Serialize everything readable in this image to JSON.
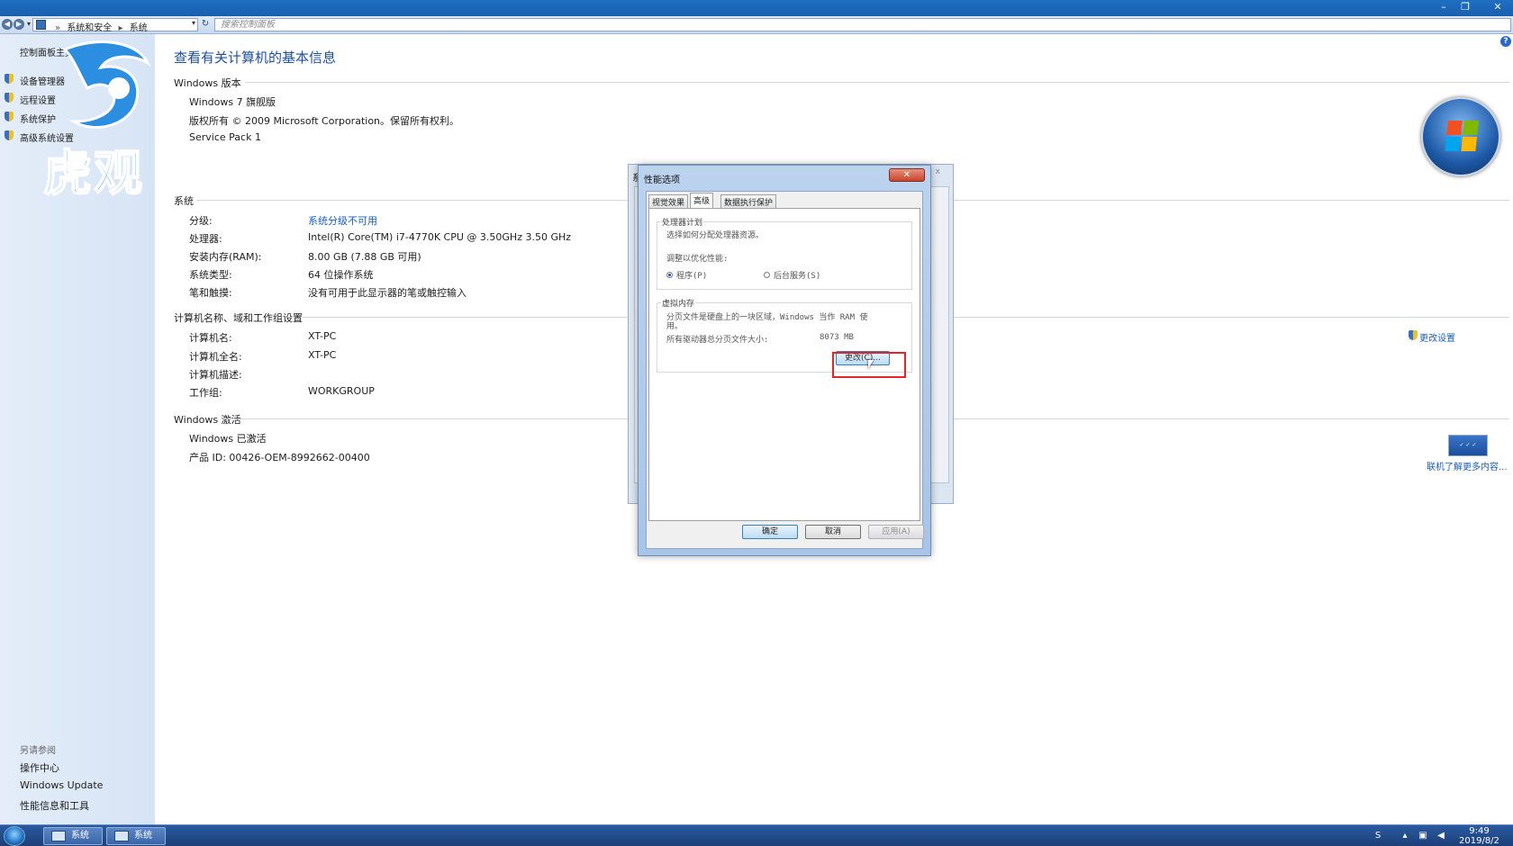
{
  "titlebar": {
    "minimize": "–",
    "maximize": "❐",
    "close": "✕"
  },
  "address": {
    "crumbs": [
      "系统和安全",
      "系统"
    ],
    "search_placeholder": "搜索控制面板"
  },
  "sidebar": {
    "home": "控制面板主页",
    "items": [
      {
        "label": "设备管理器"
      },
      {
        "label": "远程设置"
      },
      {
        "label": "系统保护"
      },
      {
        "label": "高级系统设置"
      }
    ],
    "see_also": "另请参阅",
    "links": [
      "操作中心",
      "Windows Update",
      "性能信息和工具"
    ]
  },
  "watermark": {
    "text": "虎观"
  },
  "main": {
    "title": "查看有关计算机的基本信息",
    "edition": {
      "heading": "Windows 版本",
      "lines": [
        "Windows 7 旗舰版",
        "版权所有 © 2009 Microsoft Corporation。保留所有权利。",
        "Service Pack 1"
      ]
    },
    "system": {
      "heading": "系统",
      "rows": [
        {
          "label": "分级:",
          "value": "系统分级不可用"
        },
        {
          "label": "处理器:",
          "value": "Intel(R) Core(TM) i7-4770K CPU @ 3.50GHz   3.50 GHz"
        },
        {
          "label": "安装内存(RAM):",
          "value": "8.00 GB (7.88 GB 可用)"
        },
        {
          "label": "系统类型:",
          "value": "64 位操作系统"
        },
        {
          "label": "笔和触摸:",
          "value": "没有可用于此显示器的笔或触控输入"
        }
      ]
    },
    "computer": {
      "heading": "计算机名称、域和工作组设置",
      "rows": [
        {
          "label": "计算机名:",
          "value": "XT-PC"
        },
        {
          "label": "计算机全名:",
          "value": "XT-PC"
        },
        {
          "label": "计算机描述:",
          "value": ""
        },
        {
          "label": "工作组:",
          "value": "WORKGROUP"
        }
      ],
      "change_link": "更改设置"
    },
    "activation": {
      "heading": "Windows 激活",
      "status": "Windows 已激活",
      "product_id": "产品 ID: 00426-OEM-8992662-00400",
      "learn_more": "联机了解更多内容..."
    }
  },
  "bg_dialog": {
    "title": "系",
    "close": "x"
  },
  "perf_dialog": {
    "title": "性能选项",
    "close": "✕",
    "tabs": [
      "视觉效果",
      "高级",
      "数据执行保护"
    ],
    "cpu_group": {
      "title": "处理器计划",
      "desc": "选择如何分配处理器资源。",
      "adjust": "调整以优化性能:",
      "option_programs": "程序(P)",
      "option_services": "后台服务(S)",
      "selected": "程序(P)"
    },
    "vm_group": {
      "title": "虚拟内存",
      "desc1": "分页文件是硬盘上的一块区域，Windows 当作 RAM 使",
      "desc2": "用。",
      "total_label": "所有驱动器总分页文件大小:",
      "total_value": "8073 MB",
      "change_button": "更改(C)..."
    },
    "buttons": {
      "ok": "确定",
      "cancel": "取消",
      "apply": "应用(A)"
    }
  },
  "taskbar": {
    "buttons": [
      "系统",
      "系统"
    ],
    "time": "9:49",
    "date": "2019/8/2"
  },
  "colors": {
    "link": "#1a5fb4",
    "title": "#1e4fa0",
    "highlight": "#e0252b"
  }
}
